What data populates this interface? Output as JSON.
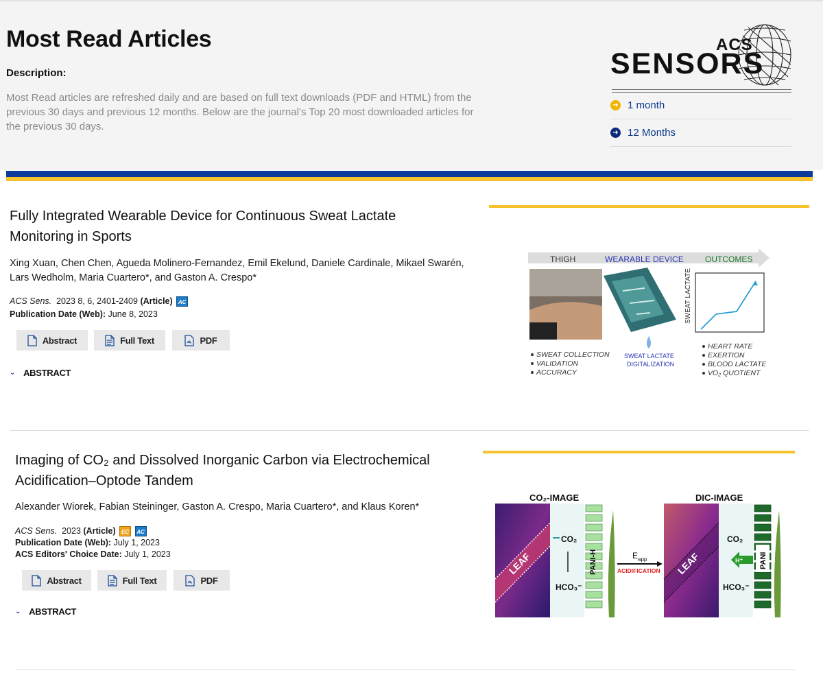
{
  "header": {
    "title": "Most Read Articles",
    "description_label": "Description:",
    "description_text": "Most Read articles are refreshed daily and are based on full text downloads (PDF and HTML) from the previous 30 days and previous 12 months. Below are the journal’s Top 20 most downloaded articles for the previous 30 days."
  },
  "logo": {
    "acs": "ACS",
    "sensors": "SENSORS"
  },
  "periods": [
    {
      "label": "1 month",
      "color": "#f0b400"
    },
    {
      "label": "12 Months",
      "color": "#0d2a7a"
    }
  ],
  "articles": [
    {
      "title_line1": "Fully Integrated Wearable Device for Continuous Sweat Lactate",
      "title_line2": "Monitoring in Sports",
      "authors_line1": "Xing Xuan, Chen Chen, Agueda Molinero-Fernandez, Emil Ekelund, Daniele Cardinale, Mikael Swarén,",
      "authors_line2": "Lars Wedholm, Maria Cuartero*, and Gaston A. Crespo*",
      "journal": "ACS Sens.",
      "citation": "2023 8, 6, 2401-2409",
      "type": "(Article)",
      "pub_label": "Publication Date (Web):",
      "pub_date": "June 8, 2023",
      "badge_ac": "AC",
      "buttons": {
        "abstract": "Abstract",
        "fulltext": "Full Text",
        "pdf": "PDF"
      },
      "abstract_toggle": "ABSTRACT",
      "toc": {
        "thigh": "THIGH",
        "wearable": "WEARABLE DEVICE",
        "outcomes": "OUTCOMES",
        "ylabel": "SWEAT LACTATE",
        "left_list": [
          "SWEAT COLLECTION",
          "VALIDATION",
          "ACCURACY"
        ],
        "drop_top": "SWEAT LACTATE",
        "drop_bottom": "DIGITALIZATION",
        "right_list": [
          "HEART RATE",
          "EXERTION",
          "BLOOD LACTATE",
          "VO₂ QUOTIENT"
        ]
      }
    },
    {
      "title_line1": "Imaging of CO₂ and Dissolved Inorganic Carbon via Electrochemical",
      "title_line2": "Acidification–Optode Tandem",
      "authors_line1": "Alexander Wiorek, Fabian Steininger, Gaston A. Crespo, Maria Cuartero*, and Klaus Koren*",
      "journal": "ACS Sens.",
      "citation": "2023",
      "type": "(Article)",
      "pub_label": "Publication Date (Web):",
      "pub_date": "July 1, 2023",
      "editors_label": "ACS Editors' Choice Date:",
      "editors_date": "July 1, 2023",
      "badge_ec": "EC",
      "badge_ac": "AC",
      "buttons": {
        "abstract": "Abstract",
        "fulltext": "Full Text",
        "pdf": "PDF"
      },
      "abstract_toggle": "ABSTRACT",
      "toc": {
        "co2_image": "CO₂-IMAGE",
        "dic_image": "DIC-IMAGE",
        "leaf": "LEAF",
        "co2": "CO₂",
        "hco3": "HCO₃⁻",
        "pani_h": "PANI-H",
        "pani": "PANI",
        "eapp": "E",
        "eapp_sub": "app",
        "acidification": "ACIDIFICATION",
        "hplus": "H⁺"
      }
    }
  ]
}
